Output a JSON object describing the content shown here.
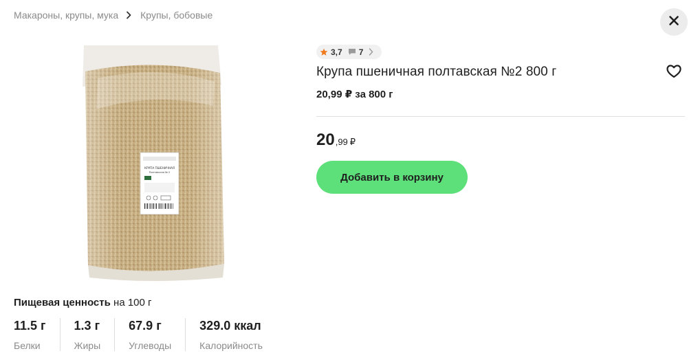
{
  "breadcrumb": {
    "items": [
      "Макароны, крупы, мука",
      "Крупы, бобовые"
    ],
    "separator_icon": "chevron-right-icon"
  },
  "close_icon": "close-icon",
  "product": {
    "rating": "3,7",
    "reviews_count": "7",
    "title": "Крупа пшеничная полтавская №2 800 г",
    "unit_price": "20,99 ₽ за 800 г",
    "price_int": "20",
    "price_frac": ",99",
    "currency": "₽",
    "add_to_cart_label": "Добавить в корзину",
    "favorite_icon": "heart-outline-icon",
    "image": {
      "label_lines": [
        "КРУПА ПШЕНИЧНАЯ",
        "Полтавская № 2"
      ]
    }
  },
  "nutrition": {
    "title_bold": "Пищевая ценность",
    "title_rest": "на 100 г",
    "items": [
      {
        "value": "11.5 г",
        "label": "Белки"
      },
      {
        "value": "1.3 г",
        "label": "Жиры"
      },
      {
        "value": "67.9 г",
        "label": "Углеводы"
      },
      {
        "value": "329.0 ккал",
        "label": "Калорийность"
      }
    ]
  },
  "colors": {
    "accent_button": "#5de07a",
    "star": "#f07a1e",
    "muted_text": "#8a8a8a"
  }
}
